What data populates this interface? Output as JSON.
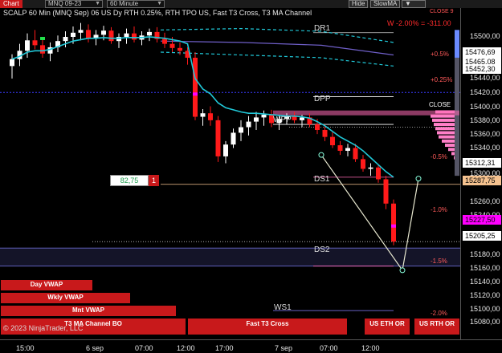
{
  "toolbar": {
    "chart_label": "Chart",
    "instrument": "MNQ 09-23",
    "interval": "60 Minute",
    "hide_label": "Hide",
    "indicator": "SlowMA"
  },
  "chart": {
    "title": "SCALP 60 Min (MNQ Sep) 06 US Dy RTH 0.25%, RTH TPO US, Fast T3 Cross, T3 MA Channel",
    "pnl": "W -2.00% = -311.00",
    "close_top": "CLOSE 9",
    "close_mid": "CLOSE",
    "copyright": "© 2023 NinjaTrader, LLC",
    "indicator_value": "82,75",
    "indicator_count": "1",
    "levels": [
      {
        "label": "DR1",
        "color": "#dddddd"
      },
      {
        "label": "DPP",
        "color": "#ffffff"
      },
      {
        "label": "WPP",
        "color": "#ffffff"
      },
      {
        "label": "DS1",
        "color": "#ff69b4"
      },
      {
        "label": "DS2",
        "color": "#ff69b4"
      },
      {
        "label": "WS1",
        "color": "#8a7fff"
      }
    ],
    "pct_labels": [
      "+0.5%",
      "+0.25%",
      "-0.5%",
      "-1.0%",
      "-1.5%",
      "-2.0%"
    ]
  },
  "buttons": {
    "day_vwap": "Day VWAP",
    "wkly_vwap": "Wkly VWAP",
    "mnt_vwap": "Mnt VWAP",
    "t3_channel": "T3 MA Channel BO",
    "fast_t3": "Fast T3 Cross",
    "us_eth": "US ETH OR",
    "us_rth": "US RTH OR"
  },
  "price_axis": {
    "ticks": [
      "15500,00",
      "15440,00",
      "15420,00",
      "15400,00",
      "15380,00",
      "15360,00",
      "15340,00",
      "15300,00",
      "15260,00",
      "15240,00",
      "15180,00",
      "15160,00",
      "15140,00",
      "15120,00",
      "15100,00",
      "15080,00"
    ],
    "badges": [
      {
        "value": "15476,69",
        "bg": "#ffffff",
        "fg": "#000000"
      },
      {
        "value": "15465,08",
        "bg": "#ffffff",
        "fg": "#000000"
      },
      {
        "value": "15452,30",
        "bg": "#ffffff",
        "fg": "#000000"
      },
      {
        "value": "15312,31",
        "bg": "#ffffff",
        "fg": "#000000"
      },
      {
        "value": "15287,75",
        "bg": "#f5c28f",
        "fg": "#000000"
      },
      {
        "value": "15227,50",
        "bg": "#ff00ff",
        "fg": "#000000"
      },
      {
        "value": "15205,25",
        "bg": "#ffffff",
        "fg": "#000000"
      }
    ]
  },
  "time_axis": [
    "15:00",
    "6 sep",
    "07:00",
    "12:00",
    "17:00",
    "7 sep",
    "07:00",
    "12:00"
  ],
  "colors": {
    "bull": "#ffffff",
    "bear": "#ff1a1a",
    "vwap": "#20c8d8",
    "channel": "#20c8d8",
    "slow_ma": "#6f5fc8"
  },
  "chart_data": {
    "type": "candlestick",
    "title": "SCALP 60 Min (MNQ Sep) 06 US Dy RTH 0.25%, RTH TPO US, Fast T3 Cross, T3 MA Channel",
    "instrument": "MNQ 09-23",
    "interval": "60 Minute",
    "ylim": [
      15068,
      15530
    ],
    "last_price": 15205.25,
    "candles": [
      {
        "o": 15458,
        "h": 15475,
        "l": 15440,
        "c": 15468
      },
      {
        "o": 15468,
        "h": 15490,
        "l": 15458,
        "c": 15480
      },
      {
        "o": 15480,
        "h": 15505,
        "l": 15470,
        "c": 15495
      },
      {
        "o": 15495,
        "h": 15510,
        "l": 15482,
        "c": 15488
      },
      {
        "o": 15488,
        "h": 15500,
        "l": 15470,
        "c": 15476
      },
      {
        "o": 15476,
        "h": 15492,
        "l": 15465,
        "c": 15485
      },
      {
        "o": 15485,
        "h": 15502,
        "l": 15478,
        "c": 15494
      },
      {
        "o": 15494,
        "h": 15508,
        "l": 15485,
        "c": 15500
      },
      {
        "o": 15500,
        "h": 15515,
        "l": 15490,
        "c": 15506
      },
      {
        "o": 15506,
        "h": 15520,
        "l": 15495,
        "c": 15510
      },
      {
        "o": 15510,
        "h": 15518,
        "l": 15492,
        "c": 15498
      },
      {
        "o": 15498,
        "h": 15510,
        "l": 15488,
        "c": 15503
      },
      {
        "o": 15503,
        "h": 15516,
        "l": 15495,
        "c": 15509
      },
      {
        "o": 15509,
        "h": 15514,
        "l": 15490,
        "c": 15494
      },
      {
        "o": 15494,
        "h": 15505,
        "l": 15484,
        "c": 15500
      },
      {
        "o": 15500,
        "h": 15512,
        "l": 15490,
        "c": 15505
      },
      {
        "o": 15505,
        "h": 15515,
        "l": 15492,
        "c": 15496
      },
      {
        "o": 15496,
        "h": 15508,
        "l": 15488,
        "c": 15502
      },
      {
        "o": 15502,
        "h": 15512,
        "l": 15494,
        "c": 15507
      },
      {
        "o": 15507,
        "h": 15514,
        "l": 15492,
        "c": 15497
      },
      {
        "o": 15497,
        "h": 15506,
        "l": 15484,
        "c": 15490
      },
      {
        "o": 15490,
        "h": 15500,
        "l": 15478,
        "c": 15484
      },
      {
        "o": 15484,
        "h": 15492,
        "l": 15474,
        "c": 15480
      },
      {
        "o": 15480,
        "h": 15485,
        "l": 15460,
        "c": 15470
      },
      {
        "o": 15470,
        "h": 15478,
        "l": 15380,
        "c": 15385
      },
      {
        "o": 15385,
        "h": 15396,
        "l": 15372,
        "c": 15390
      },
      {
        "o": 15390,
        "h": 15400,
        "l": 15372,
        "c": 15380
      },
      {
        "o": 15380,
        "h": 15386,
        "l": 15320,
        "c": 15328
      },
      {
        "o": 15328,
        "h": 15350,
        "l": 15318,
        "c": 15345
      },
      {
        "o": 15345,
        "h": 15368,
        "l": 15340,
        "c": 15362
      },
      {
        "o": 15362,
        "h": 15380,
        "l": 15350,
        "c": 15370
      },
      {
        "o": 15370,
        "h": 15386,
        "l": 15358,
        "c": 15378
      },
      {
        "o": 15378,
        "h": 15392,
        "l": 15366,
        "c": 15384
      },
      {
        "o": 15384,
        "h": 15394,
        "l": 15372,
        "c": 15388
      },
      {
        "o": 15388,
        "h": 15395,
        "l": 15370,
        "c": 15376
      },
      {
        "o": 15376,
        "h": 15388,
        "l": 15366,
        "c": 15382
      },
      {
        "o": 15382,
        "h": 15390,
        "l": 15374,
        "c": 15386
      },
      {
        "o": 15386,
        "h": 15392,
        "l": 15376,
        "c": 15380
      },
      {
        "o": 15380,
        "h": 15388,
        "l": 15370,
        "c": 15384
      },
      {
        "o": 15384,
        "h": 15390,
        "l": 15370,
        "c": 15374
      },
      {
        "o": 15374,
        "h": 15382,
        "l": 15360,
        "c": 15366
      },
      {
        "o": 15366,
        "h": 15374,
        "l": 15350,
        "c": 15356
      },
      {
        "o": 15356,
        "h": 15364,
        "l": 15340,
        "c": 15344
      },
      {
        "o": 15344,
        "h": 15350,
        "l": 15330,
        "c": 15336
      },
      {
        "o": 15336,
        "h": 15346,
        "l": 15328,
        "c": 15340
      },
      {
        "o": 15340,
        "h": 15346,
        "l": 15320,
        "c": 15324
      },
      {
        "o": 15324,
        "h": 15330,
        "l": 15306,
        "c": 15310
      },
      {
        "o": 15310,
        "h": 15318,
        "l": 15300,
        "c": 15312
      },
      {
        "o": 15312,
        "h": 15316,
        "l": 15290,
        "c": 15295
      },
      {
        "o": 15295,
        "h": 15300,
        "l": 15252,
        "c": 15260
      },
      {
        "o": 15260,
        "h": 15266,
        "l": 15200,
        "c": 15205.25
      }
    ],
    "vwap": [
      15468,
      15472,
      15478,
      15480,
      15480,
      15482,
      15486,
      15490,
      15494,
      15496,
      15498,
      15498,
      15499,
      15498,
      15498,
      15499,
      15499,
      15499,
      15500,
      15499,
      15498,
      15496,
      15494,
      15490,
      15440,
      15425,
      15418,
      15405,
      15398,
      15395,
      15392,
      15390,
      15390,
      15389,
      15388,
      15387,
      15386,
      15386,
      15385,
      15383,
      15378,
      15372,
      15364,
      15356,
      15350,
      15344,
      15336,
      15326,
      15316,
      15306,
      15298
    ],
    "pivot_levels": {
      "DR1": 15506,
      "DPP": 15414,
      "WPP": 15374,
      "DS1": 15298,
      "DS2": 15170,
      "WS1": 15106
    },
    "price_labels": [
      15476.69,
      15465.08,
      15452.3,
      15312.31,
      15287.75,
      15227.5,
      15205.25
    ]
  }
}
